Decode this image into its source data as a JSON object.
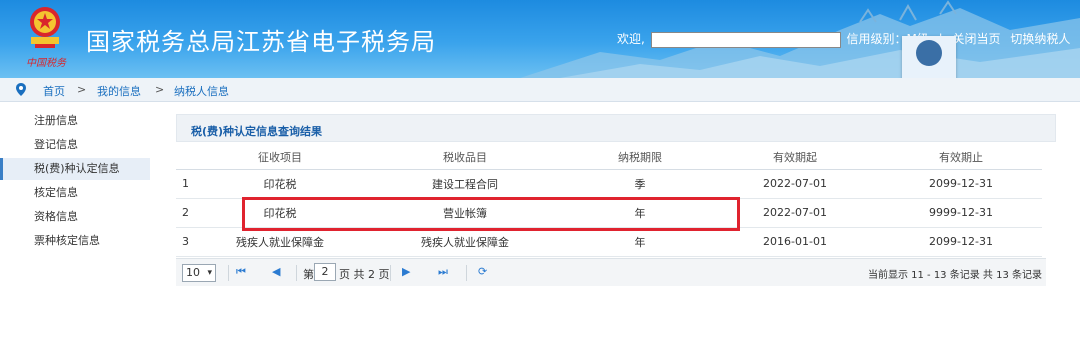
{
  "header": {
    "title": "国家税务总局江苏省电子税务局",
    "slogan": "中国税务",
    "welcome": "欢迎,",
    "credit_label": "信用级别：M级",
    "close_page": "关闭当页",
    "switch_taxpayer": "切换纳税人",
    "emblem_icon": "tax-emblem-icon",
    "avatar_icon": "user-avatar-icon"
  },
  "breadcrumb": {
    "home": "首页",
    "sep": ">",
    "my_info": "我的信息",
    "current": "纳税人信息",
    "icon": "location-pin-icon"
  },
  "sidebar": {
    "items": [
      {
        "label": "注册信息"
      },
      {
        "label": "登记信息"
      },
      {
        "label": "税(费)种认定信息"
      },
      {
        "label": "核定信息"
      },
      {
        "label": "资格信息"
      },
      {
        "label": "票种核定信息"
      }
    ],
    "active_index": 2
  },
  "panel": {
    "title": "税(费)种认定信息查询结果"
  },
  "table": {
    "headers": [
      "",
      "征收项目",
      "税收品目",
      "纳税期限",
      "有效期起",
      "有效期止"
    ],
    "rows": [
      [
        "1",
        "印花税",
        "建设工程合同",
        "季",
        "2022-07-01",
        "2099-12-31"
      ],
      [
        "2",
        "印花税",
        "营业帐簿",
        "年",
        "2022-07-01",
        "9999-12-31"
      ],
      [
        "3",
        "残疾人就业保障金",
        "残疾人就业保障金",
        "年",
        "2016-01-01",
        "2099-12-31"
      ]
    ],
    "highlighted_row": 1
  },
  "pager": {
    "page_size": "10",
    "page_prefix": "第",
    "current_page": "2",
    "page_suffix": "页 共 2 页",
    "info": "当前显示 11 - 13 条记录 共 13 条记录",
    "icons": [
      "first-page-icon",
      "prev-page-icon",
      "next-page-icon",
      "last-page-icon",
      "refresh-icon"
    ]
  },
  "colors": {
    "header_blue": "#1d8be0",
    "link_blue": "#1a6fbf",
    "highlight_red": "#e0232f"
  }
}
